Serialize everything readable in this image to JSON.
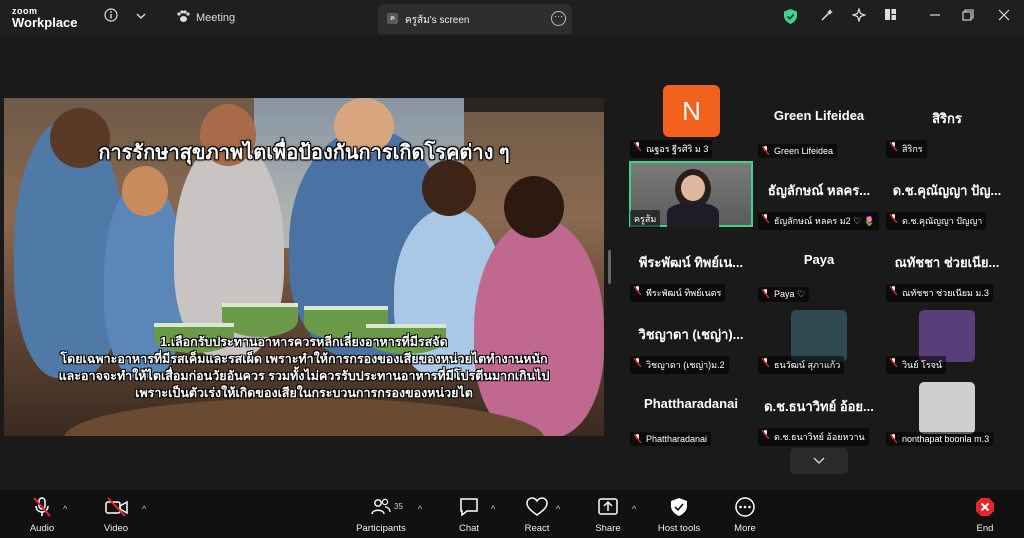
{
  "app": {
    "brand_top": "zoom",
    "brand_bottom": "Workplace",
    "meeting_tab": "Meeting",
    "share_tab": "ครูส้ม's screen",
    "share_tab_avatar": "ค"
  },
  "colors": {
    "accent_green": "#3fd28a",
    "end_red": "#e5272d",
    "avatar_orange": "#f2621e"
  },
  "shared_screen": {
    "title": "การรักษาสุขภาพไตเพื่อป้องกันการเกิดโรคต่าง ๆ",
    "lines": [
      "1.เลือกรับประทานอาหารควรหลีกเลี่ยงอาหารที่มีรสจัด",
      "โดยเฉพาะอาหารที่มีรสเค็มและรสเผ็ด เพราะทำให้การกรองของเสียของหน่วยไตทำงานหนัก",
      "และอาจจะทำให้ไตเสื่อมก่อนวัยอันควร รวมทั้งไม่ควรรับประทานอาหารที่มีโปรตีนมากเกินไป",
      "เพราะเป็นตัวเร่งให้เกิดของเสียในกระบวนการกรองของหน่วยไต"
    ]
  },
  "participants": [
    {
      "name": "",
      "label": "ณฐอร ฐีรศิริ ม 3",
      "avatar_letter": "N",
      "type": "avatar"
    },
    {
      "name": "Green Lifeidea",
      "label": "Green Lifeidea",
      "type": "name"
    },
    {
      "name": "สิริกร",
      "label": "สิริกร",
      "type": "name"
    },
    {
      "name": "",
      "label": "ครูส้ม",
      "type": "video"
    },
    {
      "name": "ธัญลักษณ์ หลคร...",
      "label": "ธัญลักษณ์ หลคร ม2 ♡ 🌷",
      "type": "name"
    },
    {
      "name": "ด.ช.คุณัญญา ปัญ...",
      "label": "ด.ช.คุณัญญา ปัญญา",
      "type": "name"
    },
    {
      "name": "พีระพัฒน์ ทิพย์เน...",
      "label": "พีระพัฒน์ ทิพย์เนตร",
      "type": "name"
    },
    {
      "name": "Paya",
      "label": "Paya ♡",
      "type": "name"
    },
    {
      "name": "ณทัชชา ช่วยเนีย...",
      "label": "ณทัชชา ช่วยเนียม ม.3",
      "type": "name"
    },
    {
      "name": "วิชญาดา (เชญ่า)...",
      "label": "วิชญาดา (เชญ่า)ม.2",
      "type": "name"
    },
    {
      "name": "",
      "label": "ธนวัฒน์ สุภาแก้ว",
      "type": "picture",
      "pic": "#2f4a52"
    },
    {
      "name": "",
      "label": "วินย์ โรจน์",
      "type": "picture",
      "pic": "#5a3e7a"
    },
    {
      "name": "Phattharadanai",
      "label": "Phattharadanai",
      "type": "name"
    },
    {
      "name": "ด.ช.ธนาวิทย์ อ้อย...",
      "label": "ด.ช.ธนาวิทย์ อ้อยหวาน",
      "type": "name"
    },
    {
      "name": "",
      "label": "nonthapat boonla m.3",
      "type": "picture",
      "pic": "#cfcfcf"
    }
  ],
  "toolbar": {
    "audio": "Audio",
    "video": "Video",
    "participants": "Participants",
    "participants_count": "35",
    "chat": "Chat",
    "react": "React",
    "share": "Share",
    "host_tools": "Host tools",
    "more": "More",
    "end": "End"
  },
  "icons": [
    "info-icon",
    "chevron-down-icon",
    "paw-icon",
    "shield-icon",
    "wand-icon",
    "sparkle-icon",
    "layout-icon",
    "minimize-icon",
    "restore-icon",
    "close-icon",
    "mic-off-icon",
    "video-off-icon",
    "people-icon",
    "chat-icon",
    "heart-icon",
    "share-icon",
    "host-shield-icon",
    "more-dots-icon",
    "end-icon"
  ]
}
